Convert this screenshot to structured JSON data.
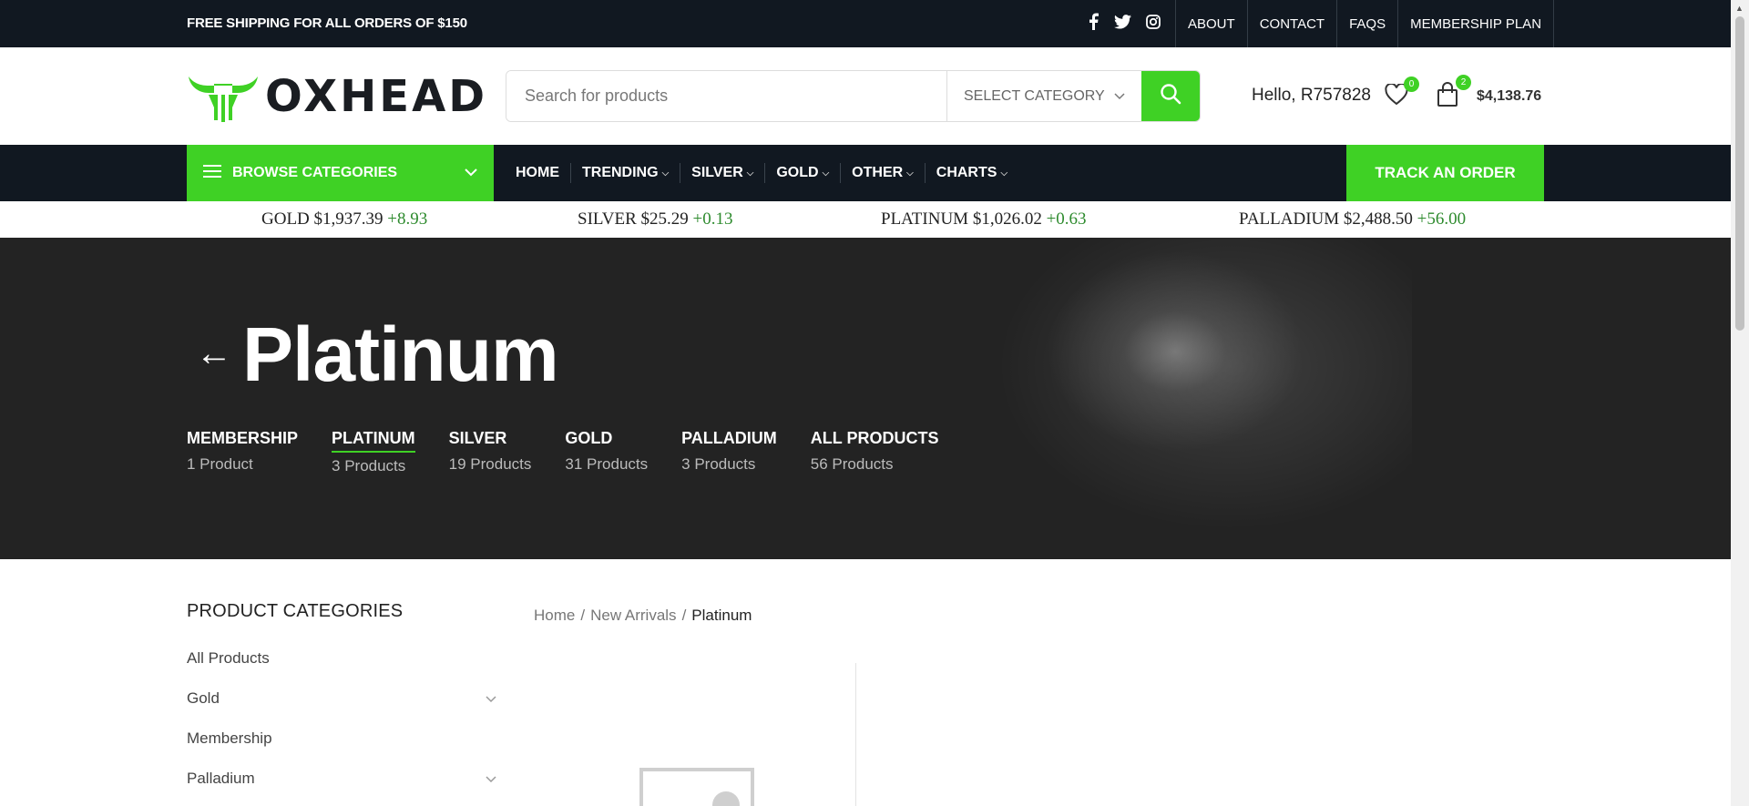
{
  "topbar": {
    "shipping": "FREE SHIPPING FOR ALL ORDERS OF $150",
    "social": [
      "facebook-icon",
      "twitter-icon",
      "instagram-icon"
    ],
    "links": [
      "ABOUT",
      "CONTACT",
      "FAQS",
      "MEMBERSHIP PLAN"
    ]
  },
  "header": {
    "logo_text": "OXHEAD",
    "search_placeholder": "Search for products",
    "category_select": "SELECT CATEGORY",
    "greeting": "Hello, R757828",
    "wishlist_count": "0",
    "cart_count": "2",
    "cart_total": "$4,138.76"
  },
  "nav": {
    "browse": "BROWSE CATEGORIES",
    "items": [
      {
        "label": "HOME",
        "dropdown": false
      },
      {
        "label": "TRENDING",
        "dropdown": true
      },
      {
        "label": "SILVER",
        "dropdown": true
      },
      {
        "label": "GOLD",
        "dropdown": true
      },
      {
        "label": "OTHER",
        "dropdown": true
      },
      {
        "label": "CHARTS",
        "dropdown": true
      }
    ],
    "track": "TRACK AN ORDER"
  },
  "ticker": [
    {
      "metal": "GOLD",
      "price": "$1,937.39",
      "change": "+8.93"
    },
    {
      "metal": "SILVER",
      "price": "$25.29",
      "change": "+0.13"
    },
    {
      "metal": "PLATINUM",
      "price": "$1,026.02",
      "change": "+0.63"
    },
    {
      "metal": "PALLADIUM",
      "price": "$2,488.50",
      "change": "+56.00"
    }
  ],
  "hero": {
    "title": "Platinum",
    "categories": [
      {
        "name": "MEMBERSHIP",
        "count": "1 Product",
        "active": false
      },
      {
        "name": "PLATINUM",
        "count": "3 Products",
        "active": true
      },
      {
        "name": "SILVER",
        "count": "19 Products",
        "active": false
      },
      {
        "name": "GOLD",
        "count": "31 Products",
        "active": false
      },
      {
        "name": "PALLADIUM",
        "count": "3 Products",
        "active": false
      },
      {
        "name": "ALL PRODUCTS",
        "count": "56 Products",
        "active": false
      }
    ]
  },
  "sidebar": {
    "title": "PRODUCT CATEGORIES",
    "items": [
      {
        "label": "All Products",
        "expandable": false
      },
      {
        "label": "Gold",
        "expandable": true
      },
      {
        "label": "Membership",
        "expandable": false
      },
      {
        "label": "Palladium",
        "expandable": true
      }
    ]
  },
  "breadcrumb": [
    "Home",
    "New Arrivals",
    "Platinum"
  ],
  "colors": {
    "accent": "#3fd125",
    "dark": "#111821",
    "change": "#2e8b2e"
  }
}
